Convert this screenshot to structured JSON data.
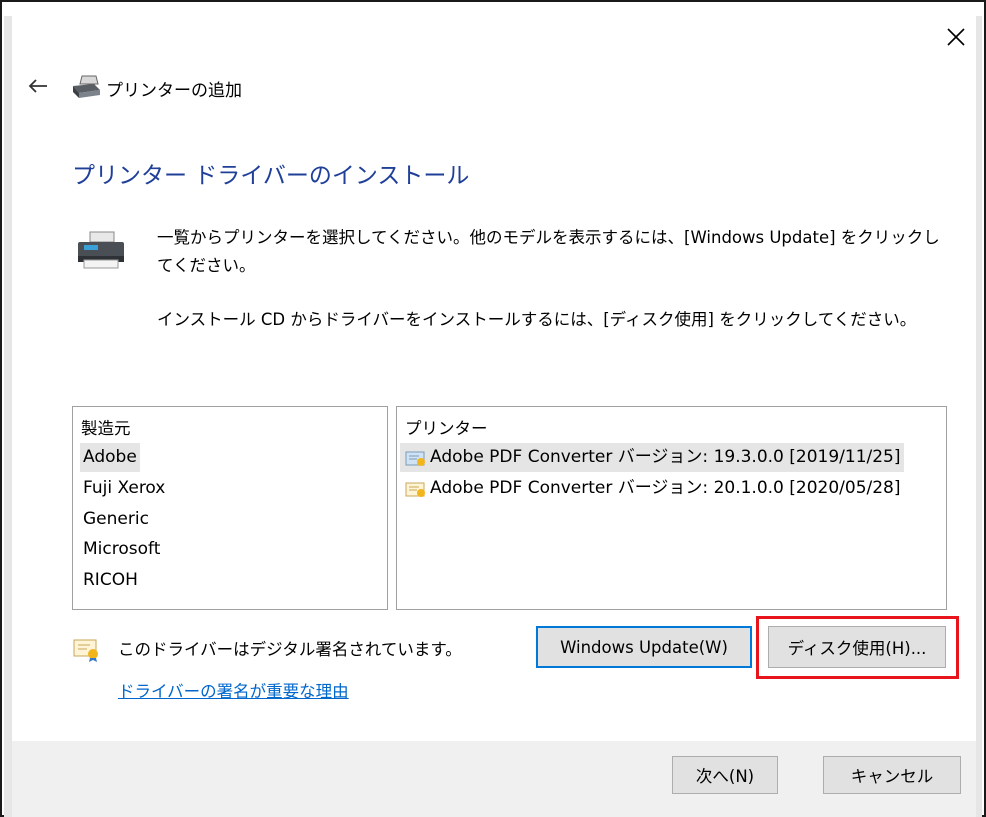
{
  "window": {
    "title": "プリンターの追加",
    "close_icon": "close-icon",
    "back_icon": "back-arrow-icon"
  },
  "page": {
    "heading": "プリンター ドライバーのインストール",
    "description_line1": "一覧からプリンターを選択してください。他のモデルを表示するには、[Windows Update] をクリックし",
    "description_line1b": "てください。",
    "description_line2": "インストール CD からドライバーをインストールするには、[ディスク使用] をクリックしてください。"
  },
  "manufacturers": {
    "header": "製造元",
    "items": [
      "Adobe",
      "Fuji Xerox",
      "Generic",
      "Microsoft",
      "RICOH"
    ],
    "selected_index": 0
  },
  "printers": {
    "header": "プリンター",
    "items": [
      "Adobe PDF Converter バージョン: 19.3.0.0 [2019/11/25]",
      "Adobe PDF Converter バージョン: 20.1.0.0 [2020/05/28]"
    ],
    "selected_index": 0
  },
  "signature": {
    "text": "このドライバーはデジタル署名されています。",
    "link": "ドライバーの署名が重要な理由"
  },
  "buttons": {
    "windows_update": "Windows Update(W)",
    "have_disk": "ディスク使用(H)...",
    "next": "次へ(N)",
    "cancel": "キャンセル"
  },
  "colors": {
    "heading": "#1f3f99",
    "link": "#0066cc",
    "highlight": "#e8141b",
    "focus": "#0078d7"
  }
}
